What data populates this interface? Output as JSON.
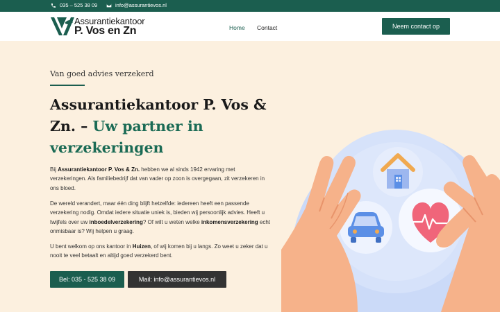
{
  "topbar": {
    "phone": "035 – 525 38 09",
    "email": "info@assurantievos.nl"
  },
  "logo": {
    "line1": "Assurantiekantoor",
    "line2": "P. Vos en Zn"
  },
  "nav": {
    "home": "Home",
    "contact": "Contact"
  },
  "header_cta": "Neem contact op",
  "hero": {
    "tagline": "Van goed advies verzekerd",
    "headline_part1": "Assurantiekantoor P. Vos & Zn. – ",
    "headline_accent": "Uw partner in verzekeringen",
    "p1": {
      "a": "Bij ",
      "b": "Assurantiekantoor P. Vos & Zn.",
      "c": " hebben we al sinds 1942 ervaring met verzekeringen. Als familiebedrijf dat van vader op zoon is overgegaan, zit verzekeren in ons bloed."
    },
    "p2": {
      "a": "De wereld verandert, maar één ding blijft hetzelfde: iedereen heeft een passende verzekering nodig. Omdat iedere situatie uniek is, bieden wij persoonlijk advies. Heeft u twijfels over uw ",
      "b": "inboedelverzekering",
      "c": "? Of wilt u weten welke ",
      "d": "inkomensverzekering",
      "e": " echt onmisbaar is? Wij helpen u graag."
    },
    "p3": {
      "a": "U bent welkom op ons kantoor in ",
      "b": "Huizen",
      "c": ", of wij komen bij u langs. Zo weet u zeker dat u nooit te veel betaalt en altijd goed verzekerd bent."
    },
    "btn_phone": "Bel: 035 - 525 38 09",
    "btn_mail": "Mail: info@assurantievos.nl"
  },
  "colors": {
    "brand": "#1b5e4f",
    "background": "#fcf0df",
    "dark_button": "#333333",
    "heart": "#f0657a",
    "car": "#5b8fe6",
    "house": "#f0a950"
  },
  "icons": [
    "phone-icon",
    "mail-icon",
    "house-icon",
    "car-icon",
    "heart-icon",
    "hands-illustration"
  ]
}
